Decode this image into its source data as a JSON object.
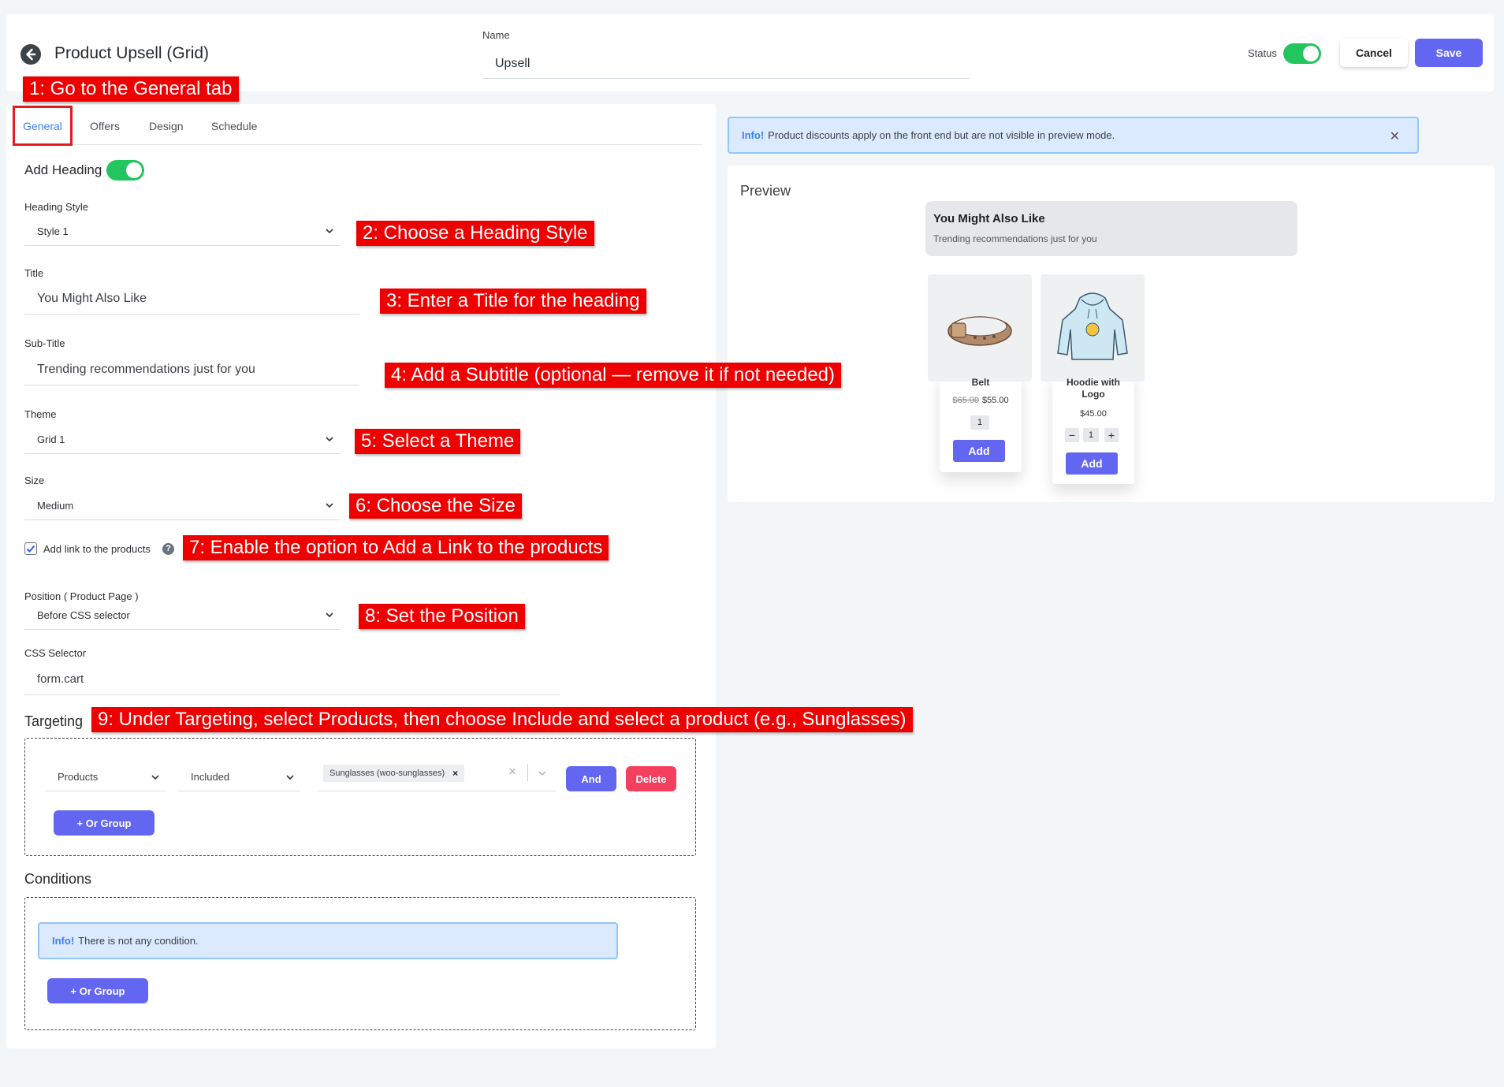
{
  "header": {
    "title": "Product Upsell (Grid)",
    "name_label": "Name",
    "name_value": "Upsell",
    "status_label": "Status",
    "status_on": true,
    "cancel_label": "Cancel",
    "save_label": "Save"
  },
  "tabs": [
    {
      "label": "General",
      "active": true
    },
    {
      "label": "Offers"
    },
    {
      "label": "Design"
    },
    {
      "label": "Schedule"
    }
  ],
  "general": {
    "add_heading_label": "Add Heading",
    "add_heading_on": true,
    "heading_style_label": "Heading Style",
    "heading_style_value": "Style 1",
    "title_label": "Title",
    "title_value": "You Might Also Like",
    "subtitle_label": "Sub-Title",
    "subtitle_value": "Trending recommendations just for you",
    "theme_label": "Theme",
    "theme_value": "Grid 1",
    "size_label": "Size",
    "size_value": "Medium",
    "add_link_label": "Add link to the products",
    "add_link_checked": true,
    "help_glyph": "?",
    "position_label": "Position ( Product Page )",
    "position_value": "Before CSS selector",
    "css_selector_label": "CSS Selector",
    "css_selector_value": "form.cart"
  },
  "targeting": {
    "heading": "Targeting",
    "type_value": "Products",
    "rule_value": "Included",
    "chip_label": "Sunglasses (woo-sunglasses)",
    "chip_remove": "×",
    "clear_glyph": "×",
    "and_label": "And",
    "delete_label": "Delete",
    "or_group_label": "+ Or Group"
  },
  "conditions": {
    "heading": "Conditions",
    "info_label": "Info!",
    "info_text": "There is not any condition.",
    "or_group_label": "+ Or Group"
  },
  "preview": {
    "info_label": "Info!",
    "info_text": "Product discounts apply on the front end but are not visible in preview mode.",
    "close_glyph": "✕",
    "title": "Preview",
    "heading": "You Might Also Like",
    "subheading": "Trending recommendations just for you",
    "products": [
      {
        "name": "Belt",
        "old_price": "$65.00",
        "price": "$55.00",
        "qty": "1",
        "add_label": "Add"
      },
      {
        "name_line1": "Hoodie with",
        "name_line2": "Logo",
        "price": "$45.00",
        "qty": "1",
        "minus": "−",
        "plus": "+",
        "add_label": "Add"
      }
    ]
  },
  "annotations": [
    "1: Go to the General tab",
    "2: Choose a Heading Style",
    "3: Enter a Title for the heading",
    "4: Add a Subtitle (optional — remove it if not needed)",
    "5: Select a Theme",
    "6: Choose the Size",
    "7: Enable the option to Add a Link to the products",
    "8: Set the Position",
    "9: Under Targeting, select Products, then choose Include and select a product (e.g., Sunglasses)"
  ],
  "colors": {
    "accent": "#6366f1",
    "toggle_on": "#22c55e",
    "danger": "#f43f5e",
    "annotation": "#ee0000",
    "info_bg": "#dbeafe"
  }
}
